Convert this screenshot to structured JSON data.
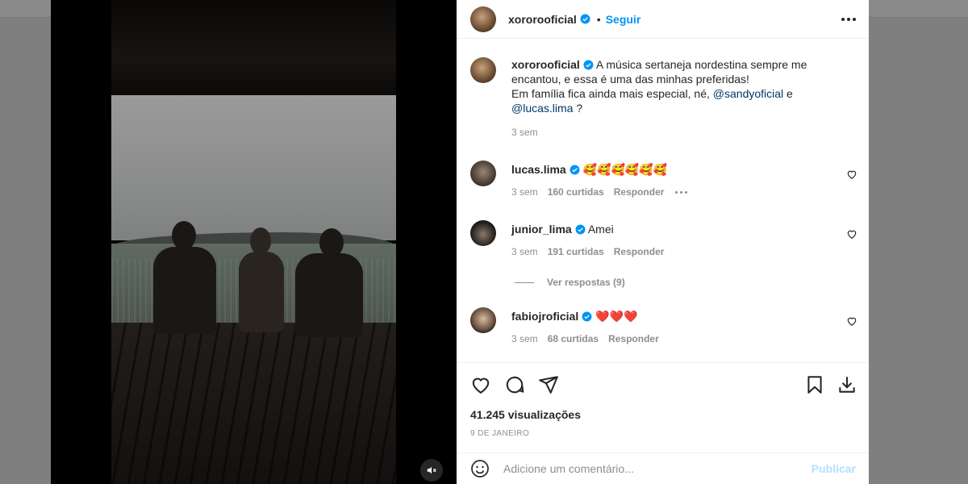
{
  "post": {
    "author": "xororooficial",
    "follow_label": "Seguir",
    "separator": "•",
    "caption_text": "A música sertaneja nordestina sempre me encantou, e essa é uma das minhas preferidas!",
    "caption_line2_prefix": "Em família fica ainda mais especial, né,",
    "mention1": "@sandyoficial",
    "caption_connector": "e",
    "mention2": "@lucas.lima",
    "caption_suffix": "?",
    "caption_time": "3 sem"
  },
  "comments": [
    {
      "username": "lucas.lima",
      "text": "🥰🥰🥰🥰🥰🥰",
      "time": "3 sem",
      "likes": "160 curtidas",
      "reply_label": "Responder"
    },
    {
      "username": "junior_lima",
      "text": "Amei",
      "time": "3 sem",
      "likes": "191 curtidas",
      "reply_label": "Responder"
    },
    {
      "username": "fabiojroficial",
      "text": "❤️❤️❤️",
      "time": "3 sem",
      "likes": "68 curtidas",
      "reply_label": "Responder"
    }
  ],
  "view_replies": "Ver respostas (9)",
  "stats": {
    "views": "41.245 visualizações",
    "date": "9 DE JANEIRO"
  },
  "comment_box": {
    "placeholder": "Adicione um comentário...",
    "publish_label": "Publicar"
  },
  "icons": {
    "verified": "verified-badge-icon",
    "more": "more-options-icon",
    "like": "heart-icon",
    "comment": "comment-bubble-icon",
    "share": "paper-plane-icon",
    "save": "bookmark-icon",
    "download": "download-icon",
    "emoji": "emoji-smiley-icon",
    "mute": "speaker-muted-icon"
  },
  "colors": {
    "accent": "#0095f6",
    "publish_disabled": "#b2dffc",
    "text": "#262626",
    "secondary": "#8e8e8e",
    "mention": "#00376b"
  }
}
